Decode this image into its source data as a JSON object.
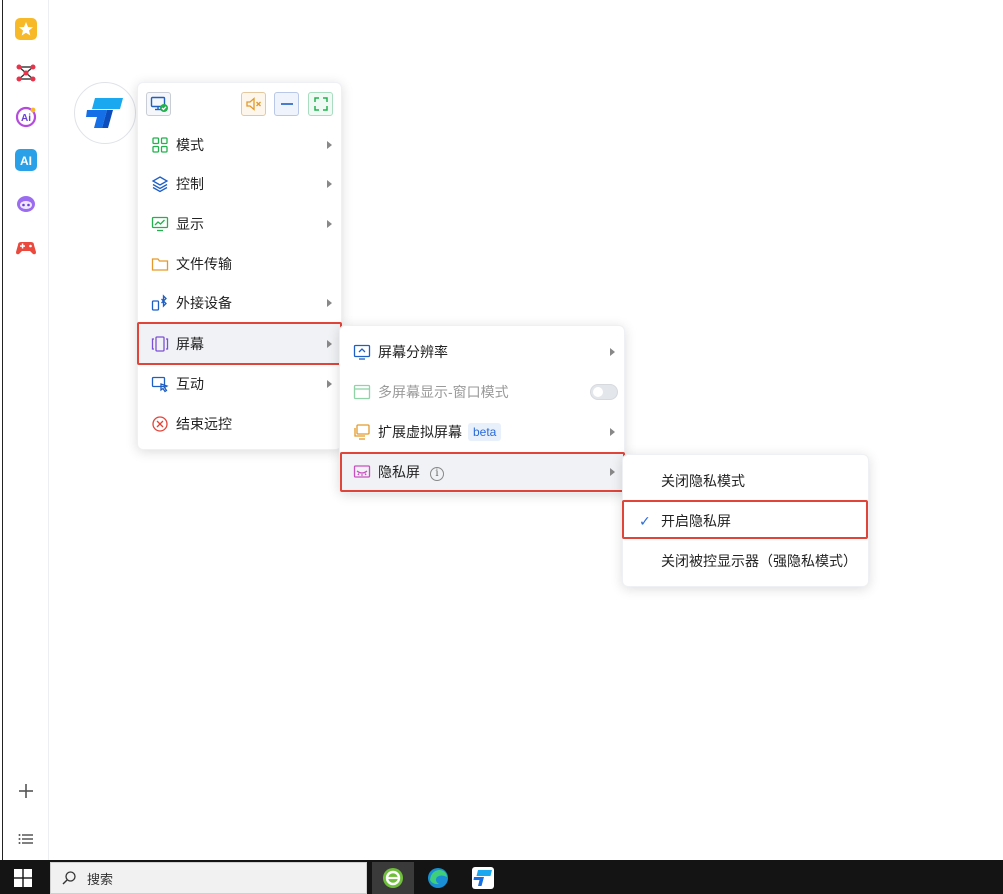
{
  "sidebar": {
    "icons": [
      "star-icon",
      "network-icon",
      "ai-assistant-icon",
      "ai-icon",
      "chat-bot-icon",
      "gamepad-icon"
    ],
    "bottom": [
      "plus-icon",
      "list-icon"
    ]
  },
  "toolbar": {
    "buttons": [
      "screen-check-icon",
      "mute-icon",
      "minimize-icon",
      "fullscreen-icon"
    ]
  },
  "main_menu": {
    "items": [
      {
        "label": "模式",
        "icon": "grid-icon",
        "has_submenu": true
      },
      {
        "label": "控制",
        "icon": "layers-icon",
        "has_submenu": true
      },
      {
        "label": "显示",
        "icon": "monitor-chart-icon",
        "has_submenu": true
      },
      {
        "label": "文件传输",
        "icon": "folder-icon",
        "has_submenu": false
      },
      {
        "label": "外接设备",
        "icon": "bluetooth-device-icon",
        "has_submenu": true
      },
      {
        "label": "屏幕",
        "icon": "screen-icon",
        "has_submenu": true,
        "active": true
      },
      {
        "label": "互动",
        "icon": "interaction-icon",
        "has_submenu": true
      },
      {
        "label": "结束远控",
        "icon": "close-circle-icon",
        "has_submenu": false
      }
    ]
  },
  "screen_submenu": {
    "items": [
      {
        "label": "屏幕分辨率",
        "icon": "resolution-icon",
        "has_submenu": true
      },
      {
        "label": "多屏幕显示-窗口模式",
        "icon": "window-mode-icon",
        "disabled": true,
        "toggle": false
      },
      {
        "label": "扩展虚拟屏幕",
        "icon": "virtual-screen-icon",
        "badge": "beta",
        "has_submenu": true
      },
      {
        "label": "隐私屏",
        "icon": "privacy-screen-icon",
        "info": "i",
        "has_submenu": true,
        "active": true
      }
    ]
  },
  "privacy_submenu": {
    "items": [
      {
        "label": "关闭隐私模式",
        "checked": false
      },
      {
        "label": "开启隐私屏",
        "checked": true
      },
      {
        "label": "关闭被控显示器（强隐私模式）",
        "checked": false
      }
    ],
    "check_mark": "✓"
  },
  "taskbar": {
    "search_label": "搜索",
    "apps": [
      "green-browser-icon",
      "edge-icon",
      "todesk-icon"
    ]
  },
  "colors": {
    "highlight_border": "#e0453a",
    "accent": "#2b6bd6"
  }
}
